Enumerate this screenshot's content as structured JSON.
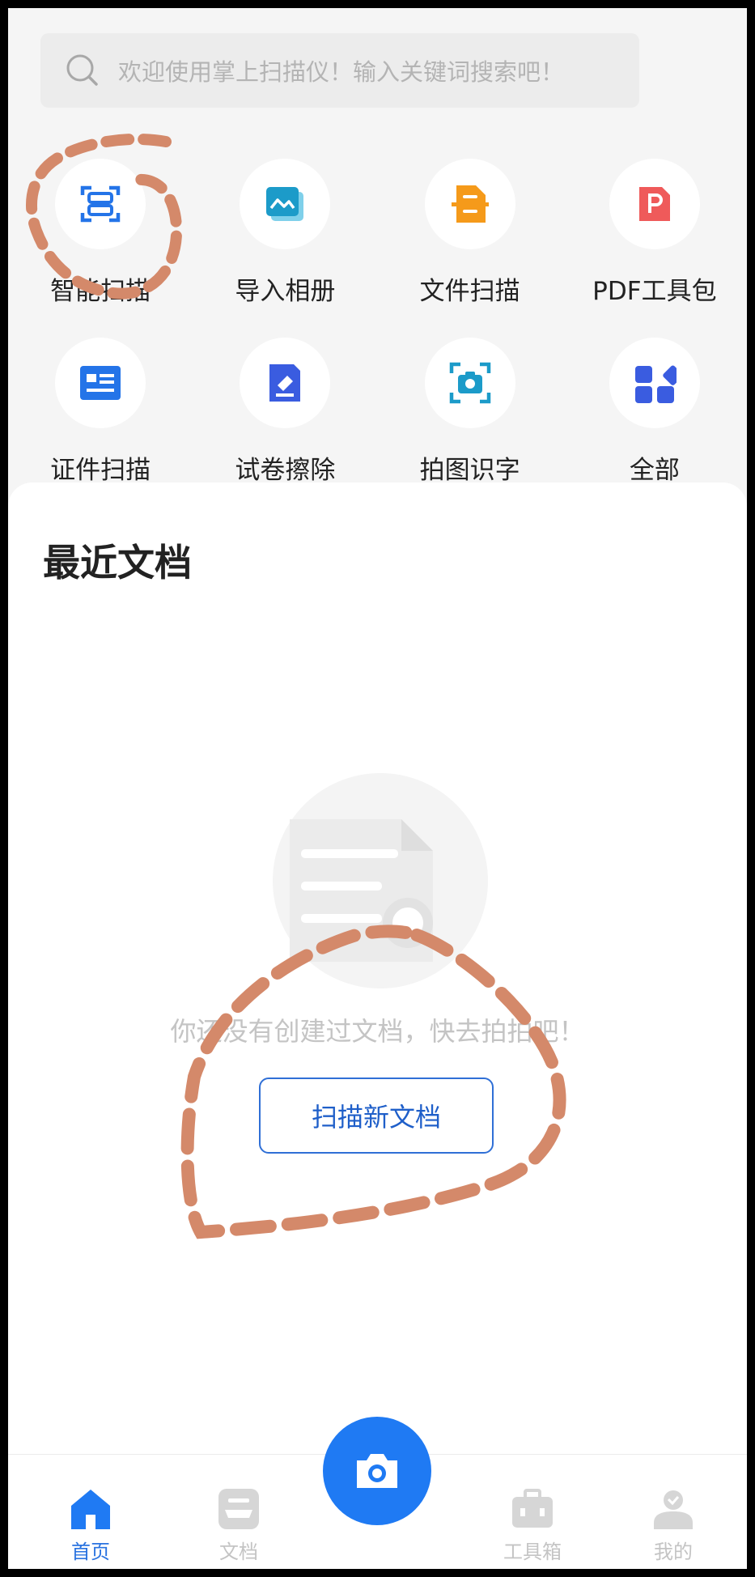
{
  "search": {
    "placeholder": "欢迎使用掌上扫描仪！输入关键词搜索吧！"
  },
  "tools": [
    {
      "label": "智能扫描",
      "icon": "smart-scan-icon",
      "color": "#2474e8"
    },
    {
      "label": "导入相册",
      "icon": "photo-import-icon",
      "color": "#1c9bc9"
    },
    {
      "label": "文件扫描",
      "icon": "file-scan-icon",
      "color": "#f59a1a"
    },
    {
      "label": "PDF工具包",
      "icon": "pdf-icon",
      "color": "#ef5a5a"
    },
    {
      "label": "证件扫描",
      "icon": "id-card-icon",
      "color": "#2474e8"
    },
    {
      "label": "试卷擦除",
      "icon": "eraser-icon",
      "color": "#3a5ce0"
    },
    {
      "label": "拍图识字",
      "icon": "camera-ocr-icon",
      "color": "#1c9bc9"
    },
    {
      "label": "全部",
      "icon": "all-apps-icon",
      "color": "#3a5ce0"
    }
  ],
  "recent": {
    "title": "最近文档",
    "empty_text": "你还没有创建过文档，快去拍拍吧！",
    "scan_button": "扫描新文档"
  },
  "nav": {
    "home": "首页",
    "docs": "文档",
    "toolbox": "工具箱",
    "mine": "我的",
    "active": "home"
  },
  "colors": {
    "accent": "#1f7af3",
    "annotation": "#d4896a"
  }
}
